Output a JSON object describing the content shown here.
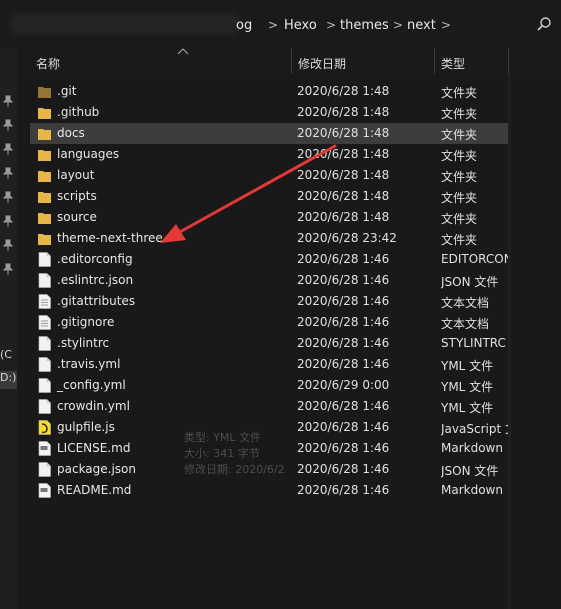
{
  "address": {
    "crumbs": [
      "og",
      "Hexo",
      "themes",
      "next"
    ],
    "separator": ">"
  },
  "nav": {
    "drives": [
      "(C",
      "D:)"
    ]
  },
  "columns": {
    "name": "名称",
    "date": "修改日期",
    "type": "类型"
  },
  "files": [
    {
      "name": ".git",
      "date": "2020/6/28 1:48",
      "type": "文件夹",
      "icon": "folder-icon"
    },
    {
      "name": ".github",
      "date": "2020/6/28 1:48",
      "type": "文件夹",
      "icon": "folder-icon"
    },
    {
      "name": "docs",
      "date": "2020/6/28 1:48",
      "type": "文件夹",
      "icon": "folder-icon"
    },
    {
      "name": "languages",
      "date": "2020/6/28 1:48",
      "type": "文件夹",
      "icon": "folder-icon"
    },
    {
      "name": "layout",
      "date": "2020/6/28 1:48",
      "type": "文件夹",
      "icon": "folder-icon"
    },
    {
      "name": "scripts",
      "date": "2020/6/28 1:48",
      "type": "文件夹",
      "icon": "folder-icon"
    },
    {
      "name": "source",
      "date": "2020/6/28 1:48",
      "type": "文件夹",
      "icon": "folder-icon"
    },
    {
      "name": "theme-next-three",
      "date": "2020/6/28 23:42",
      "type": "文件夹",
      "icon": "folder-icon"
    },
    {
      "name": ".editorconfig",
      "date": "2020/6/28 1:46",
      "type": "EDITORCONFIG",
      "icon": "file-icon"
    },
    {
      "name": ".eslintrc.json",
      "date": "2020/6/28 1:46",
      "type": "JSON 文件",
      "icon": "file-icon"
    },
    {
      "name": ".gitattributes",
      "date": "2020/6/28 1:46",
      "type": "文本文档",
      "icon": "text-file-icon"
    },
    {
      "name": ".gitignore",
      "date": "2020/6/28 1:46",
      "type": "文本文档",
      "icon": "text-file-icon"
    },
    {
      "name": ".stylintrc",
      "date": "2020/6/28 1:46",
      "type": "STYLINTRC",
      "icon": "file-icon"
    },
    {
      "name": ".travis.yml",
      "date": "2020/6/28 1:46",
      "type": "YML 文件",
      "icon": "file-icon"
    },
    {
      "name": "_config.yml",
      "date": "2020/6/29 0:00",
      "type": "YML 文件",
      "icon": "file-icon"
    },
    {
      "name": "crowdin.yml",
      "date": "2020/6/28 1:46",
      "type": "YML 文件",
      "icon": "file-icon"
    },
    {
      "name": "gulpfile.js",
      "date": "2020/6/28 1:46",
      "type": "JavaScript 文件",
      "icon": "js-file-icon"
    },
    {
      "name": "LICENSE.md",
      "date": "2020/6/28 1:46",
      "type": "Markdown",
      "icon": "md-file-icon"
    },
    {
      "name": "package.json",
      "date": "2020/6/28 1:46",
      "type": "JSON 文件",
      "icon": "file-icon"
    },
    {
      "name": "README.md",
      "date": "2020/6/28 1:46",
      "type": "Markdown",
      "icon": "md-file-icon"
    }
  ],
  "selected_row": "docs",
  "tooltip": {
    "type_line": "类型: YML 文件",
    "size_line": "大小: 341 字节",
    "date_line": "修改日期: 2020/6/2"
  },
  "colors": {
    "background": "#191919",
    "selected": "#3d3d3d",
    "folder": "#e8b645",
    "annotation_arrow": "#e53935"
  }
}
